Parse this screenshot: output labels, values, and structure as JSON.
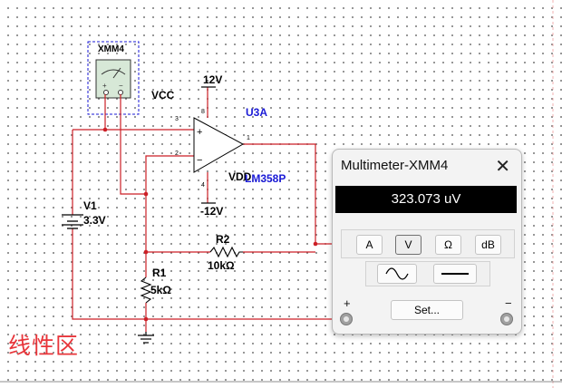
{
  "schematic": {
    "xmm_label": "XMM4",
    "vcc_label": "VCC",
    "vdd_label": "VDD",
    "pos_supply": "12V",
    "neg_supply": "-12V",
    "opamp_name": "U3A",
    "opamp_model": "LM358P",
    "pin_3": "3",
    "pin_2": "2",
    "pin_1": "1",
    "pin_8": "8",
    "pin_4": "4",
    "source_name": "V1",
    "source_value": "3.3V",
    "r2_name": "R2",
    "r2_value": "10kΩ",
    "r1_name": "R1",
    "r1_value": "5kΩ",
    "note_text": "线性区",
    "wire_color": "#cc1f26",
    "label_color_blue": "#1a1ad6",
    "note_color": "#e8353a"
  },
  "multimeter": {
    "title": "Multimeter-XMM4",
    "close_icon": "close-icon",
    "reading": "323.073 uV",
    "buttons": [
      "A",
      "V",
      "Ω",
      "dB"
    ],
    "selected_button": "V",
    "ac_icon": "sine-wave-icon",
    "dc_icon": "dc-line-icon",
    "set_label": "Set...",
    "plus_label": "+",
    "minus_label": "−"
  }
}
